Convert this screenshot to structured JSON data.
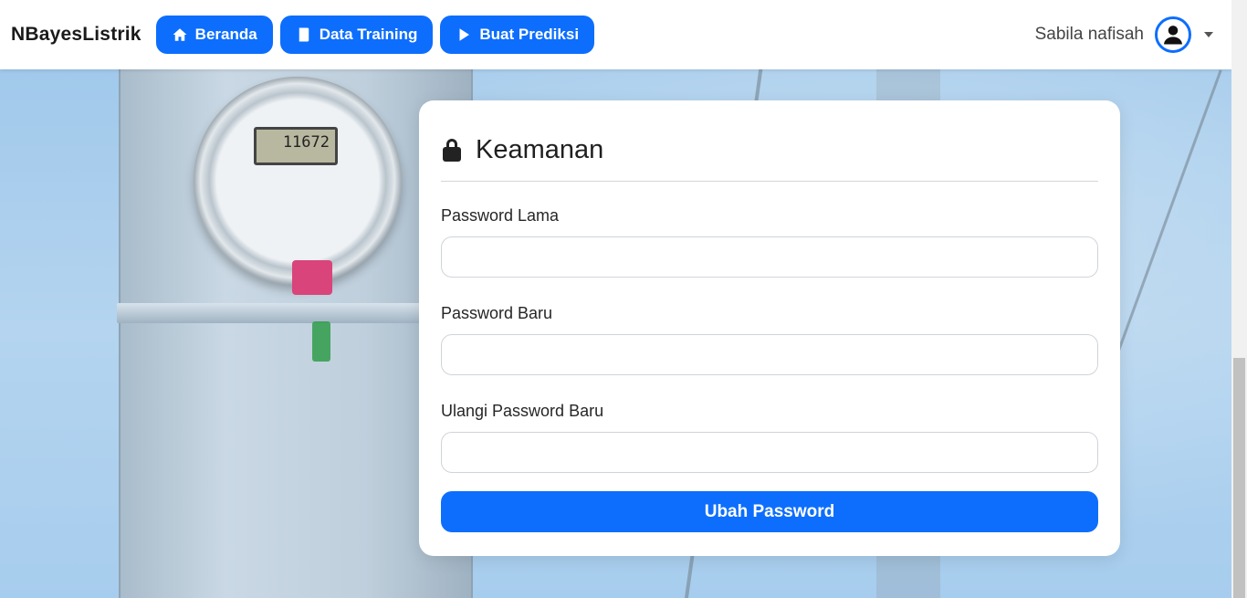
{
  "navbar": {
    "brand": "NBayesListrik",
    "buttons": [
      {
        "label": "Beranda",
        "icon": "home-icon"
      },
      {
        "label": "Data Training",
        "icon": "book-icon"
      },
      {
        "label": "Buat Prediksi",
        "icon": "play-icon"
      }
    ],
    "user": {
      "name": "Sabila nafisah",
      "avatar_icon": "user-circle-icon"
    }
  },
  "card": {
    "title": "Keamanan",
    "title_icon": "lock-icon",
    "fields": [
      {
        "label": "Password Lama",
        "value": ""
      },
      {
        "label": "Password Baru",
        "value": ""
      },
      {
        "label": "Ulangi Password Baru",
        "value": ""
      }
    ],
    "submit_label": "Ubah Password"
  },
  "background": {
    "meter_reading": "11672"
  },
  "colors": {
    "primary": "#0d6efd",
    "navbar_bg": "#ffffff",
    "card_bg": "#ffffff"
  }
}
